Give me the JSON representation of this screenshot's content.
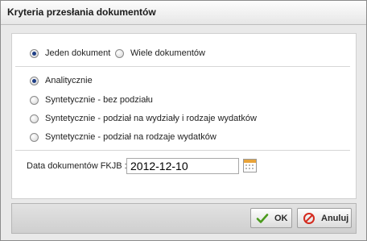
{
  "dialog": {
    "title": "Kryteria przesłania dokumentów"
  },
  "mode": {
    "options": [
      {
        "label": "Jeden dokument",
        "checked": true
      },
      {
        "label": "Wiele dokumentów",
        "checked": false
      }
    ]
  },
  "report_type": {
    "options": [
      {
        "label": "Analitycznie",
        "checked": true
      },
      {
        "label": "Syntetycznie - bez podziału",
        "checked": false
      },
      {
        "label": "Syntetycznie - podział na wydziały i rodzaje wydatków",
        "checked": false
      },
      {
        "label": "Syntetycznie - podział na rodzaje wydatków",
        "checked": false
      }
    ]
  },
  "date_field": {
    "label": "Data dokumentów FKJB :",
    "value": "2012-12-10"
  },
  "footer": {
    "ok_label": "OK",
    "cancel_label": "Anuluj"
  },
  "icons": {
    "ok": "check-icon",
    "cancel": "cancel-icon",
    "calendar": "calendar-icon"
  },
  "colors": {
    "ok_icon": "#4a9a1c",
    "cancel_icon": "#d42a1e",
    "calendar": "#e8a33a"
  }
}
